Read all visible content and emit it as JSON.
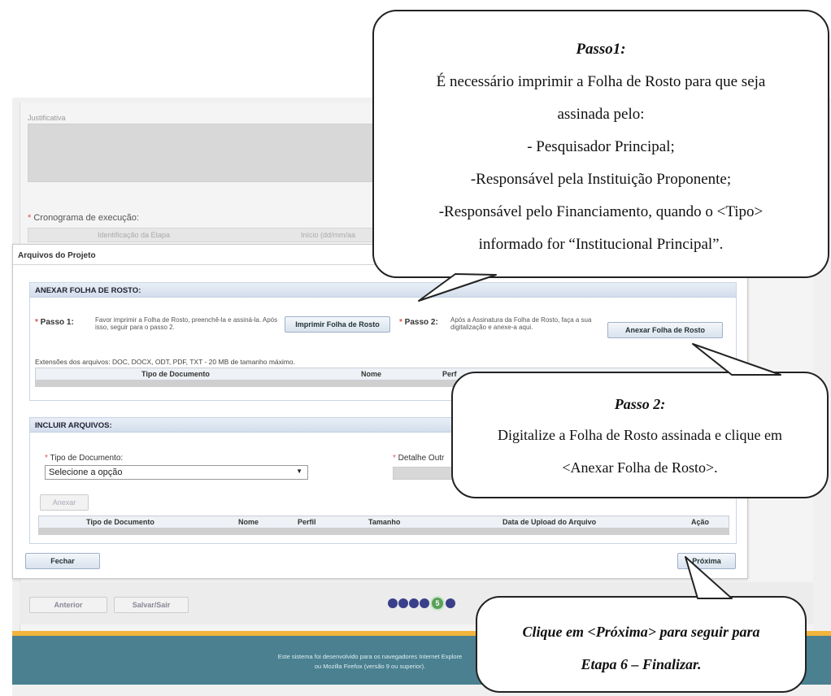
{
  "background": {
    "justificativa_label": "Justificativa",
    "cronograma_label": "Cronograma de execução:",
    "cronograma_columns": [
      "Identificação da Etapa",
      "Início (dd/mm/aa"
    ]
  },
  "modal": {
    "title": "Arquivos do Projeto",
    "folha_section": {
      "header": "ANEXAR FOLHA DE ROSTO:",
      "passo1_label": "Passo 1:",
      "passo1_text": "Favor imprimir a Folha de Rosto, preenchê-la e assiná-la. Após isso, seguir para o passo 2.",
      "imprimir_button": "Imprimir Folha de Rosto",
      "passo2_label": "Passo 2:",
      "passo2_text": "Após a Assinatura da Folha de Rosto, faça a sua digitalização e anexe-a aqui.",
      "anexar_button": "Anexar Folha de Rosto",
      "extensions_text": "Extensões dos arquivos: DOC, DOCX, ODT, PDF, TXT - 20 MB de tamanho máximo.",
      "columns": [
        "Tipo de Documento",
        "Nome",
        "Perf"
      ]
    },
    "incluir_section": {
      "header": "INCLUIR ARQUIVOS:",
      "tipo_label": "Tipo de Documento:",
      "tipo_value": "Selecione a opção",
      "detalhe_label": "Detalhe Outr",
      "anexar_button": "Anexar",
      "columns": [
        "Tipo de Documento",
        "Nome",
        "Perfil",
        "Tamanho",
        "Data de Upload do Arquivo",
        "Ação"
      ]
    },
    "fechar_button": "Fechar",
    "proxima_button": "Próxima"
  },
  "nav": {
    "anterior_button": "Anterior",
    "salvar_button": "Salvar/Sair",
    "steps_completed": 4,
    "current_step": "5"
  },
  "footer": {
    "line1": "Este sistema foi desenvolvido para os navegadores Internet Explore",
    "line2": "ou Mozilla Firefox (versão 9 ou superior)."
  },
  "callouts": {
    "passo1": {
      "title": "Passo1:",
      "lines": [
        "É necessário imprimir a Folha de Rosto para que seja",
        "assinada pelo:",
        "- Pesquisador Principal;",
        "-Responsável pela Instituição Proponente;",
        "-Responsável pelo Financiamento, quando o <Tipo>",
        "informado for “Institucional Principal”."
      ]
    },
    "passo2": {
      "title": "Passo 2:",
      "lines": [
        "Digitalize a Folha de Rosto assinada e clique em",
        "<Anexar Folha de Rosto>."
      ]
    },
    "proxima": {
      "lines": [
        "Clique em <Próxima> para seguir para",
        "Etapa 6 – Finalizar."
      ]
    }
  }
}
